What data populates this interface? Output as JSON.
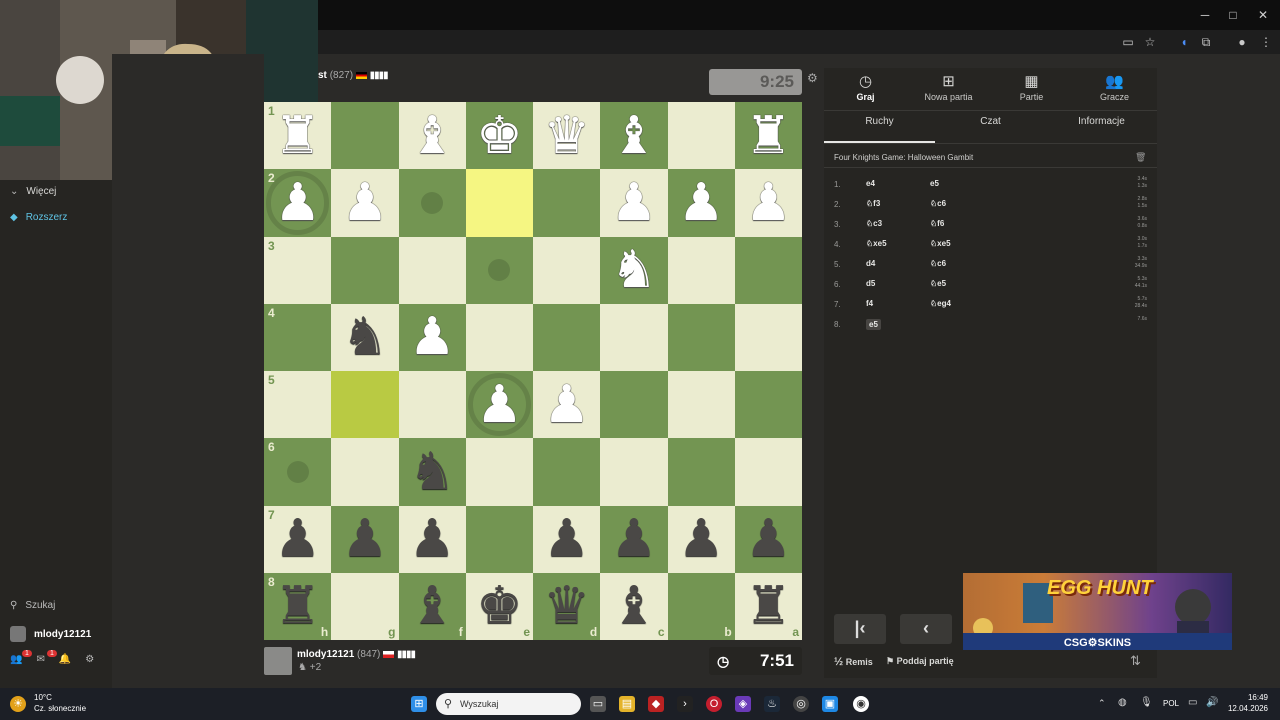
{
  "window": {
    "minimize": "─",
    "maximize": "□",
    "close": "✕"
  },
  "sidebar": {
    "more_label": "Więcej",
    "upgrade_label": "Rozszerz",
    "search_label": "Szukaj",
    "username": "mlody12121",
    "messages_badge": "1",
    "mail_badge": "1"
  },
  "opponent": {
    "name": "st",
    "rating": "(827)",
    "flag": "germany",
    "clock": "9:25"
  },
  "player": {
    "name": "mlody12121",
    "rating": "(847)",
    "flag": "poland",
    "captured": "+2",
    "clock": "7:51"
  },
  "board": {
    "orientation": "black",
    "ranks": [
      "1",
      "2",
      "3",
      "4",
      "5",
      "6",
      "7",
      "8"
    ],
    "files": [
      "h",
      "g",
      "f",
      "e",
      "d",
      "c",
      "b",
      "a"
    ],
    "rows": [
      [
        "R",
        "",
        "B",
        "K",
        "Q",
        "B",
        "",
        "R"
      ],
      [
        "P",
        "P",
        "",
        "",
        "",
        "P",
        "P",
        "P"
      ],
      [
        "",
        "",
        "",
        "",
        "",
        "N",
        "",
        ""
      ],
      [
        "",
        "n",
        "P",
        "",
        "",
        "",
        "",
        ""
      ],
      [
        "",
        "",
        "",
        "P",
        "P",
        "",
        "",
        ""
      ],
      [
        "",
        "",
        "n",
        "",
        "",
        "",
        "",
        ""
      ],
      [
        "p",
        "p",
        "p",
        "",
        "p",
        "p",
        "p",
        "p"
      ],
      [
        "r",
        "",
        "b",
        "k",
        "q",
        "b",
        "",
        "r"
      ]
    ],
    "highlight_squares": [
      "1,3",
      "4,1"
    ],
    "move_hints": [
      "1,2",
      "2,3",
      "5,0"
    ],
    "capture_rings": [
      "1,0",
      "4,3"
    ]
  },
  "right_panel": {
    "top_tabs": [
      {
        "label": "Graj",
        "icon": "clock-icon"
      },
      {
        "label": "Nowa partia",
        "icon": "plus-icon"
      },
      {
        "label": "Partie",
        "icon": "board-icon"
      },
      {
        "label": "Gracze",
        "icon": "users-icon"
      }
    ],
    "sub_tabs": [
      "Ruchy",
      "Czat",
      "Informacje"
    ],
    "opening": "Four Knights Game: Halloween Gambit",
    "moves": [
      {
        "num": "1.",
        "white": "e4",
        "black": "e5",
        "tw": "3.4s",
        "tb": "1.3s"
      },
      {
        "num": "2.",
        "white": "♘f3",
        "black": "♘c6",
        "tw": "2.8s",
        "tb": "1.5s"
      },
      {
        "num": "3.",
        "white": "♘c3",
        "black": "♘f6",
        "tw": "3.6s",
        "tb": "0.8s"
      },
      {
        "num": "4.",
        "white": "♘xe5",
        "black": "♘xe5",
        "tw": "3.0s",
        "tb": "1.7s"
      },
      {
        "num": "5.",
        "white": "d4",
        "black": "♘c6",
        "tw": "3.3s",
        "tb": "34.9s"
      },
      {
        "num": "6.",
        "white": "d5",
        "black": "♘e5",
        "tw": "5.3s",
        "tb": "44.1s"
      },
      {
        "num": "7.",
        "white": "f4",
        "black": "♘eg4",
        "tw": "5.7s",
        "tb": "28.4s"
      },
      {
        "num": "8.",
        "white": "e5",
        "black": "",
        "tw": "7.6s",
        "tb": ""
      }
    ],
    "draw_label": "Remis",
    "draw_prefix": "½",
    "resign_label": "Poddaj partię"
  },
  "ad": {
    "title": "EGG HUNT",
    "brand": "CSG⚙SKINS"
  },
  "taskbar": {
    "weather_temp": "10°C",
    "weather_desc": "Cz. słonecznie",
    "search_placeholder": "Wyszukaj",
    "lang": "POL",
    "time": "16:49",
    "date": "12.04.2026"
  },
  "colors": {
    "board_light": "#ebecd0",
    "board_dark": "#739552",
    "highlight": "#f5f682",
    "panel": "#262522"
  }
}
